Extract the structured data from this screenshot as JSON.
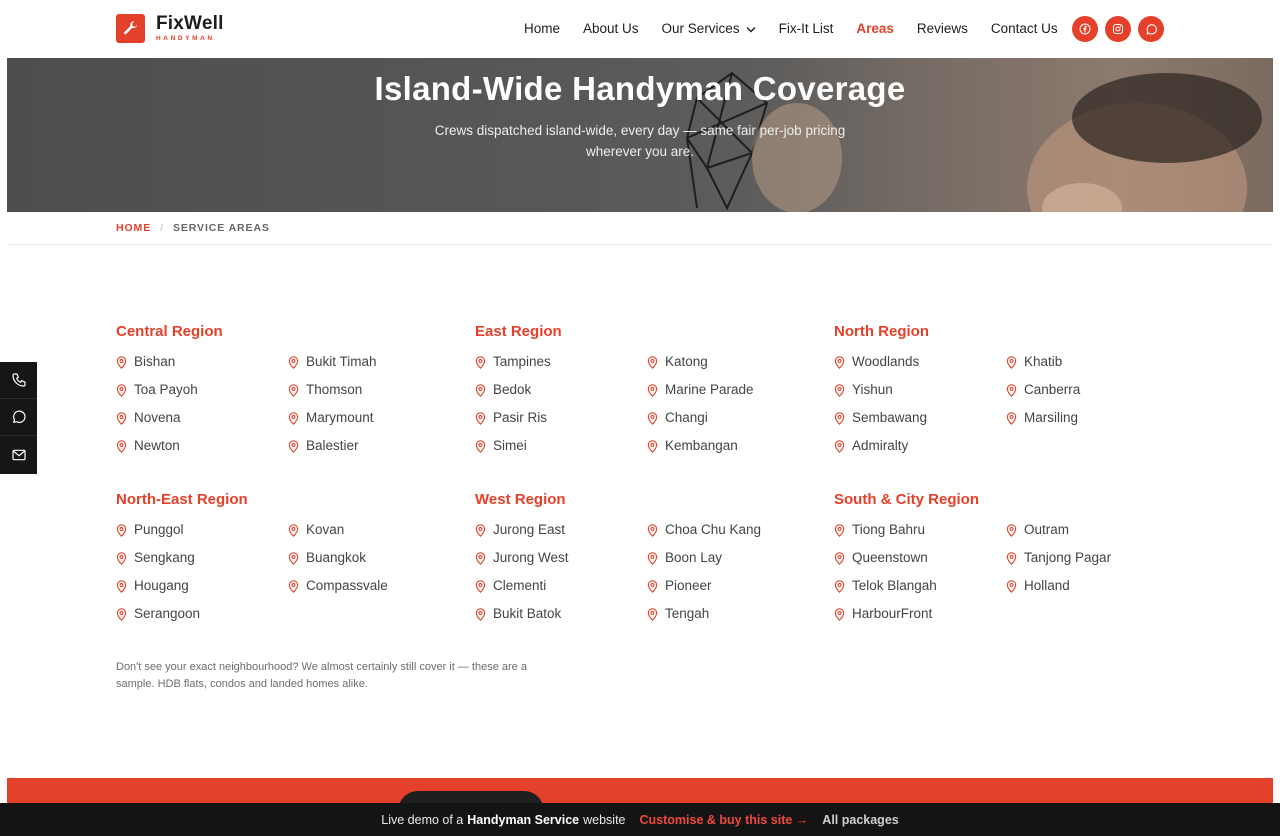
{
  "brand": {
    "name": "FixWell",
    "tagline": "HANDYMAN",
    "accent": "#e5402a"
  },
  "nav": {
    "items": [
      {
        "label": "Home",
        "active": false,
        "dropdown": false
      },
      {
        "label": "About Us",
        "active": false,
        "dropdown": false
      },
      {
        "label": "Our Services",
        "active": false,
        "dropdown": true
      },
      {
        "label": "Fix-It List",
        "active": false,
        "dropdown": false
      },
      {
        "label": "Areas",
        "active": true,
        "dropdown": false
      },
      {
        "label": "Reviews",
        "active": false,
        "dropdown": false
      },
      {
        "label": "Contact Us",
        "active": false,
        "dropdown": false
      }
    ],
    "socials": [
      "facebook-icon",
      "instagram-icon",
      "whatsapp-icon"
    ]
  },
  "hero": {
    "title": "Island-Wide Handyman Coverage",
    "subtitle": "Crews dispatched island-wide, every day — same fair per-job pricing wherever you are."
  },
  "breadcrumb": {
    "home": "HOME",
    "separator": "/",
    "current": "SERVICE AREAS"
  },
  "regions": [
    {
      "title": "Central Region",
      "areas": [
        "Bishan",
        "Toa Payoh",
        "Novena",
        "Newton",
        "Bukit Timah",
        "Thomson",
        "Marymount",
        "Balestier"
      ]
    },
    {
      "title": "East Region",
      "areas": [
        "Tampines",
        "Bedok",
        "Pasir Ris",
        "Simei",
        "Katong",
        "Marine Parade",
        "Changi",
        "Kembangan"
      ]
    },
    {
      "title": "North Region",
      "areas": [
        "Woodlands",
        "Yishun",
        "Sembawang",
        "Admiralty",
        "Khatib",
        "Canberra",
        "Marsiling"
      ]
    },
    {
      "title": "North-East Region",
      "areas": [
        "Punggol",
        "Sengkang",
        "Hougang",
        "Serangoon",
        "Kovan",
        "Buangkok",
        "Compassvale"
      ]
    },
    {
      "title": "West Region",
      "areas": [
        "Jurong East",
        "Jurong West",
        "Clementi",
        "Bukit Batok",
        "Choa Chu Kang",
        "Boon Lay",
        "Pioneer",
        "Tengah"
      ]
    },
    {
      "title": "South & City Region",
      "areas": [
        "Tiong Bahru",
        "Queenstown",
        "Telok Blangah",
        "HarbourFront",
        "Outram",
        "Tanjong Pagar",
        "Holland"
      ]
    }
  ],
  "note": "Don't see your exact neighbourhood? We almost certainly still cover it — these are a sample. HDB flats, condos and landed homes alike.",
  "side_dock": [
    "phone-icon",
    "chat-icon",
    "mail-icon"
  ],
  "demo_bar": {
    "prefix": "Live demo of a",
    "site_type": "Handyman Service",
    "suffix": "website",
    "cta": "Customise & buy this site →",
    "packages": "All packages"
  }
}
